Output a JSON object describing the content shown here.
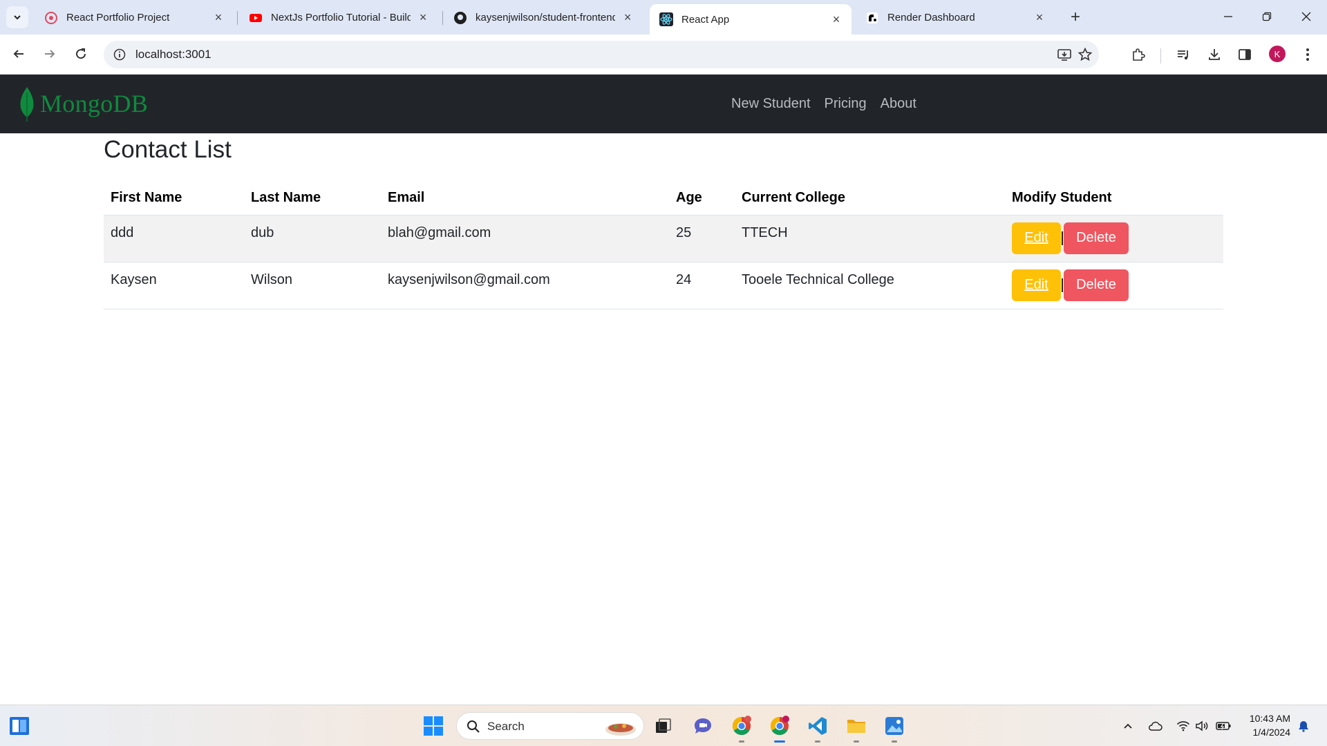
{
  "browser": {
    "tabs": [
      {
        "title": "React Portfolio Project",
        "icon": "react-portfolio-favicon"
      },
      {
        "title": "NextJs Portfolio Tutorial - Build",
        "icon": "youtube-favicon"
      },
      {
        "title": "kaysenjwilson/student-frontend",
        "icon": "github-favicon"
      },
      {
        "title": "React App",
        "icon": "react-favicon",
        "active": true
      },
      {
        "title": "Render Dashboard",
        "icon": "render-favicon"
      }
    ],
    "url": "localhost:3001",
    "profile_initial": "K"
  },
  "app": {
    "brand": "MongoDB",
    "brand_color": "#0f8a3e",
    "nav": [
      "New Student",
      "Pricing",
      "About"
    ],
    "page_title": "Contact List",
    "columns": [
      "First Name",
      "Last Name",
      "Email",
      "Age",
      "Current College",
      "Modify Student"
    ],
    "rows": [
      {
        "first": "ddd",
        "last": "dub",
        "email": "blah@gmail.com",
        "age": "25",
        "college": "TTECH"
      },
      {
        "first": "Kaysen",
        "last": "Wilson",
        "email": "kaysenjwilson@gmail.com",
        "age": "24",
        "college": "Tooele Technical College"
      }
    ],
    "edit_label": "Edit",
    "delete_label": "Delete",
    "colors": {
      "edit": "#ffc107",
      "delete": "#ef5660",
      "navbar": "#212529"
    }
  },
  "taskbar": {
    "search_placeholder": "Search",
    "time": "10:43 AM",
    "date": "1/4/2024"
  }
}
